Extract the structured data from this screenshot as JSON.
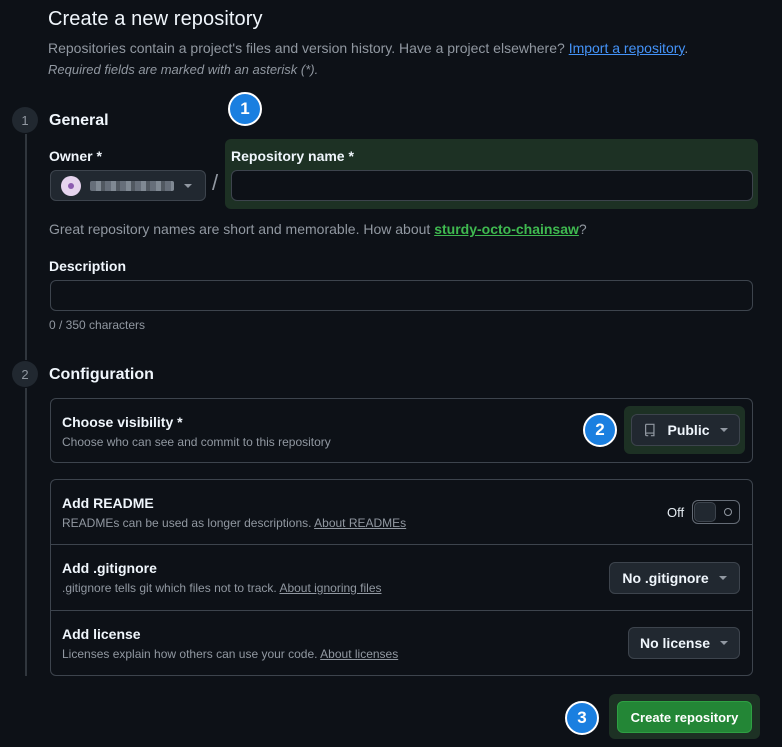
{
  "header": {
    "title": "Create a new repository",
    "intro_text": "Repositories contain a project's files and version history. Have a project elsewhere?",
    "import_link": "Import a repository",
    "intro_end": ".",
    "required_note": "Required fields are marked with an asterisk (*)."
  },
  "general": {
    "step": "1",
    "title": "General",
    "owner_label": "Owner *",
    "separator": "/",
    "repo_name_label": "Repository name *",
    "repo_name_value": "",
    "suggestion_prefix": "Great repository names are short and memorable. How about",
    "suggestion_name": "sturdy-octo-chainsaw",
    "suggestion_suffix": "?",
    "description_label": "Description",
    "description_value": "",
    "char_count": "0 / 350 characters"
  },
  "configuration": {
    "step": "2",
    "title": "Configuration",
    "visibility": {
      "title": "Choose visibility *",
      "desc": "Choose who can see and commit to this repository",
      "value": "Public"
    },
    "readme": {
      "title": "Add README",
      "desc": "READMEs can be used as longer descriptions.",
      "link": "About READMEs",
      "toggle_label": "Off"
    },
    "gitignore": {
      "title": "Add .gitignore",
      "desc": ".gitignore tells git which files not to track.",
      "link": "About ignoring files",
      "value": "No .gitignore"
    },
    "license": {
      "title": "Add license",
      "desc": "Licenses explain how others can use your code.",
      "link": "About licenses",
      "value": "No license"
    }
  },
  "actions": {
    "create_label": "Create repository"
  },
  "callouts": [
    "1",
    "2",
    "3"
  ],
  "colors": {
    "background": "#0d1117",
    "primary_button": "#238636",
    "callout": "#1a7fe0",
    "highlight": "#1d3124",
    "link": "#4493f8",
    "suggestion": "#3fb950"
  }
}
